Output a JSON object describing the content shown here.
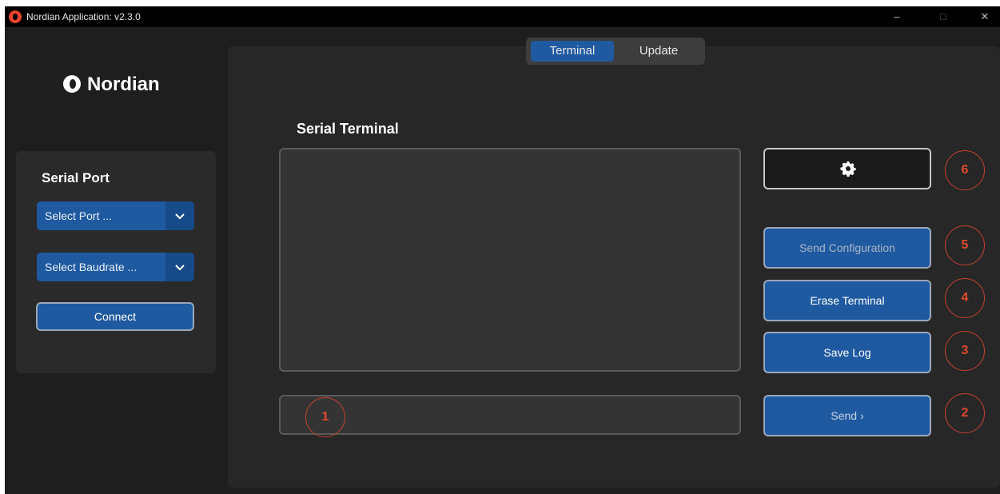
{
  "window": {
    "title": "Nordian Application: v2.3.0",
    "controls": {
      "minimize": "–",
      "maximize": "□",
      "close": "✕"
    }
  },
  "sidebar": {
    "logo_text": "Nordian",
    "panel_title": "Serial Port",
    "port_select": {
      "value": "Select Port ...",
      "icon": "chevron-down-icon"
    },
    "baud_select": {
      "value": "Select Baudrate ...",
      "icon": "chevron-down-icon"
    },
    "connect_label": "Connect"
  },
  "tabs": [
    {
      "label": "Terminal",
      "active": true
    },
    {
      "label": "Update",
      "active": false
    }
  ],
  "main": {
    "section_title": "Serial Terminal",
    "terminal_output": "",
    "input_value": ""
  },
  "buttons": {
    "settings_icon": "gear-icon",
    "send_configuration": "Send Configuration",
    "erase_terminal": "Erase Terminal",
    "save_log": "Save Log",
    "send": "Send  ›"
  },
  "annotations": [
    "1",
    "2",
    "3",
    "4",
    "5",
    "6"
  ],
  "colors": {
    "accent": "#1f5aa1",
    "background": "#1e1e1e",
    "annotation": "#c2412f"
  }
}
